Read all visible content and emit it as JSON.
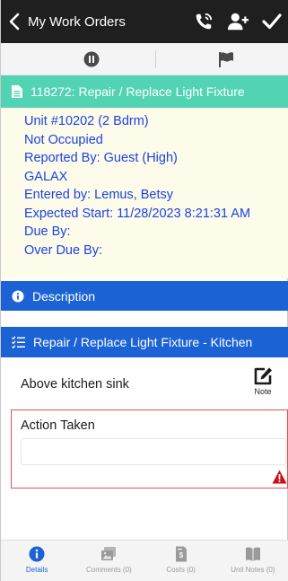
{
  "header": {
    "back_label": "My Work Orders"
  },
  "order": {
    "title": "118272: Repair / Replace Light Fixture"
  },
  "info_lines": [
    "Unit #10202 (2 Bdrm)",
    "Not Occupied",
    "Reported By: Guest  (High)",
    "GALAX",
    "Entered by: Lemus, Betsy",
    "Expected Start: 11/28/2023 8:21:31 AM",
    "Due By:",
    "Over Due By:"
  ],
  "sections": {
    "description_label": "Description",
    "task_label": "Repair / Replace Light Fixture - Kitchen"
  },
  "task": {
    "text": "Above kitchen sink",
    "note_label": "Note"
  },
  "action": {
    "label": "Action Taken",
    "value": "",
    "placeholder": ""
  },
  "tabs": [
    {
      "label": "Details",
      "icon": "info-icon",
      "active": true
    },
    {
      "label": "Comments (0)",
      "icon": "image-icon",
      "active": false
    },
    {
      "label": "Costs (0)",
      "icon": "invoice-icon",
      "active": false
    },
    {
      "label": "Unit Notes (0)",
      "icon": "book-icon",
      "active": false
    }
  ],
  "colors": {
    "navbar": "#1f1f1f",
    "order_header": "#52d3b3",
    "info_background": "#fdfbe9",
    "info_text": "#1b43e3",
    "section_bar": "#1b63d4",
    "error": "#e45050",
    "warning": "#c8101a"
  }
}
